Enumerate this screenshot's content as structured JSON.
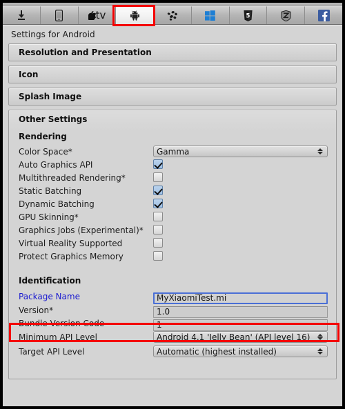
{
  "window": {
    "settings_title": "Settings for Android"
  },
  "toolbar": {
    "tabs": [
      {
        "name": "standalone",
        "icon": "download-icon",
        "selected": false
      },
      {
        "name": "ios",
        "icon": "iphone-icon",
        "selected": false
      },
      {
        "name": "tvos",
        "icon": "appletv-icon",
        "selected": false
      },
      {
        "name": "android",
        "icon": "android-icon",
        "selected": true
      },
      {
        "name": "samsungtv",
        "icon": "samsung-tv-icon",
        "selected": false
      },
      {
        "name": "windows",
        "icon": "windows-icon",
        "selected": false
      },
      {
        "name": "webgl",
        "icon": "html5-icon",
        "selected": false
      },
      {
        "name": "tizen",
        "icon": "tizen-icon",
        "selected": false
      },
      {
        "name": "facebook",
        "icon": "facebook-icon",
        "selected": false
      }
    ]
  },
  "foldouts": [
    {
      "label": "Resolution and Presentation"
    },
    {
      "label": "Icon"
    },
    {
      "label": "Splash Image"
    }
  ],
  "other_settings": {
    "label": "Other Settings",
    "rendering": {
      "label": "Rendering",
      "rows": [
        {
          "label": "Color Space*",
          "type": "popup",
          "value": "Gamma"
        },
        {
          "label": "Auto Graphics API",
          "type": "checkbox",
          "checked": true
        },
        {
          "label": "Multithreaded Rendering*",
          "type": "checkbox",
          "checked": false
        },
        {
          "label": "Static Batching",
          "type": "checkbox",
          "checked": true
        },
        {
          "label": "Dynamic Batching",
          "type": "checkbox",
          "checked": true
        },
        {
          "label": "GPU Skinning*",
          "type": "checkbox",
          "checked": false
        },
        {
          "label": "Graphics Jobs (Experimental)*",
          "type": "checkbox",
          "checked": false
        },
        {
          "label": "Virtual Reality Supported",
          "type": "checkbox",
          "checked": false
        },
        {
          "label": "Protect Graphics Memory",
          "type": "checkbox",
          "checked": false
        }
      ]
    },
    "identification": {
      "label": "Identification",
      "rows": [
        {
          "label": "Package Name",
          "type": "text",
          "value": "MyXiaomiTest.mi",
          "modified": true,
          "focused": true
        },
        {
          "label": "Version*",
          "type": "text",
          "value": "1.0"
        },
        {
          "label": "Bundle Version Code",
          "type": "text",
          "value": "1"
        },
        {
          "label": "Minimum API Level",
          "type": "popup",
          "value": "Android 4.1 'Jelly Bean' (API level 16)"
        },
        {
          "label": "Target API Level",
          "type": "popup",
          "value": "Automatic (highest installed)"
        }
      ]
    }
  },
  "annotations": {
    "color": "#f40000",
    "boxes": [
      {
        "name": "android-tab-highlight"
      },
      {
        "name": "package-name-highlight"
      }
    ]
  }
}
